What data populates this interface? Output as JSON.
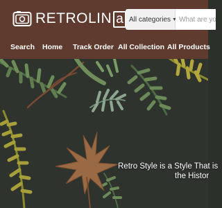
{
  "brand": {
    "name": "RETROLIN",
    "name_box": "a"
  },
  "search": {
    "category": "All categories",
    "placeholder": "What are you"
  },
  "nav": {
    "items": [
      "Search",
      "Home",
      "Track Order",
      "All Collection",
      "All Products"
    ]
  },
  "hero": {
    "line1": "Retro Style is a Style That is",
    "line2": "the Histor"
  },
  "colors": {
    "header": "#5e3b2e",
    "hero_bg": "#2e332e",
    "text": "#ffffff"
  }
}
